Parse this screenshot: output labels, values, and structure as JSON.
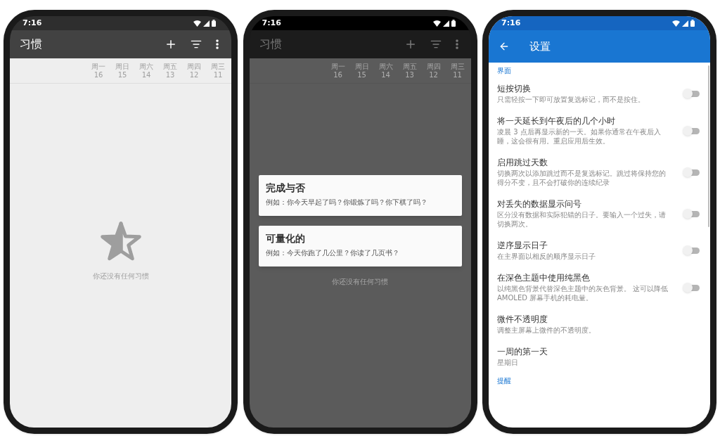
{
  "screens": [
    {
      "kind": "habits",
      "status_time": "7:16",
      "title": "习惯",
      "days": [
        {
          "weekday": "周一",
          "date": "16"
        },
        {
          "weekday": "周日",
          "date": "15"
        },
        {
          "weekday": "周六",
          "date": "14"
        },
        {
          "weekday": "周五",
          "date": "13"
        },
        {
          "weekday": "周四",
          "date": "12"
        },
        {
          "weekday": "周三",
          "date": "11"
        }
      ],
      "empty_text": "你还没有任何习惯"
    },
    {
      "kind": "habit_type_dialog",
      "status_time": "7:16",
      "title": "习惯",
      "days": [
        {
          "weekday": "周一",
          "date": "16"
        },
        {
          "weekday": "周日",
          "date": "15"
        },
        {
          "weekday": "周六",
          "date": "14"
        },
        {
          "weekday": "周五",
          "date": "13"
        },
        {
          "weekday": "周四",
          "date": "12"
        },
        {
          "weekday": "周三",
          "date": "11"
        }
      ],
      "empty_text": "你还没有任何习惯",
      "options": [
        {
          "title": "完成与否",
          "example": "例如：你今天早起了吗？你锻炼了吗？你下棋了吗？"
        },
        {
          "title": "可量化的",
          "example": "例如：今天你跑了几公里？你读了几页书？"
        }
      ]
    },
    {
      "kind": "settings",
      "status_time": "7:16",
      "title": "设置",
      "items": [
        {
          "kind": "header",
          "title": "界面"
        },
        {
          "kind": "toggle",
          "title": "短按切换",
          "description": "只需轻按一下即可放置复选标记，而不是按住。",
          "on": false
        },
        {
          "kind": "toggle",
          "title": "将一天延长到午夜后的几个小时",
          "description": "凌晨 3 点后再显示新的一天。如果你通常在午夜后入睡，这会很有用。重启应用后生效。",
          "on": false
        },
        {
          "kind": "toggle",
          "title": "启用跳过天数",
          "description": "切换两次以添加跳过而不是复选标记。跳过将保持您的得分不变，且不会打破你的连续纪录",
          "on": false
        },
        {
          "kind": "toggle",
          "title": "对丢失的数据显示问号",
          "description": "区分没有数据和实际犯错的日子。要输入一个过失，请切换两次。",
          "on": false
        },
        {
          "kind": "toggle",
          "title": "逆序显示日子",
          "description": "在主界面以相反的顺序显示日子",
          "on": false
        },
        {
          "kind": "toggle",
          "title": "在深色主题中使用纯黑色",
          "description": "以纯黑色背景代替深色主题中的灰色背景。 这可以降低 AMOLED 屏幕手机的耗电量。",
          "on": false
        },
        {
          "kind": "plain",
          "title": "微件不透明度",
          "description": "调整主屏幕上微件的不透明度。"
        },
        {
          "kind": "plain",
          "title": "一周的第一天",
          "description": "星期日"
        },
        {
          "kind": "header",
          "title": "提醒"
        }
      ]
    }
  ]
}
